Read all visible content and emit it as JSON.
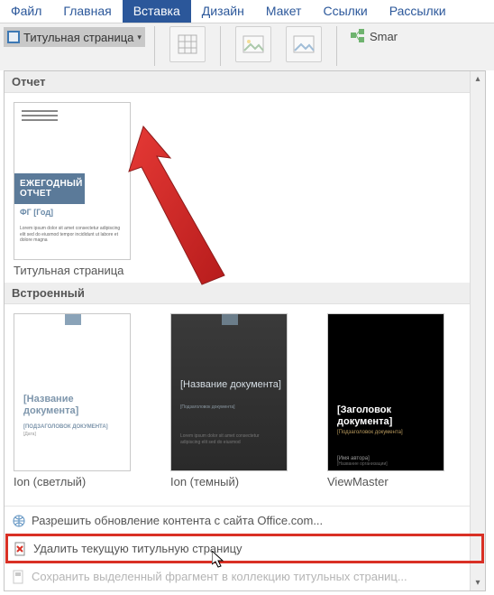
{
  "menubar": {
    "items": [
      {
        "label": "Файл"
      },
      {
        "label": "Главная"
      },
      {
        "label": "Вставка",
        "active": true
      },
      {
        "label": "Дизайн"
      },
      {
        "label": "Макет"
      },
      {
        "label": "Ссылки"
      },
      {
        "label": "Рассылки"
      }
    ]
  },
  "ribbon": {
    "cover_page_label": "Титульная страница",
    "smartart_label": "Smar"
  },
  "gallery": {
    "section1_title": "Отчет",
    "report": {
      "title": "ЕЖЕГОДНЫЙ ОТЧЕТ",
      "subtitle": "ФГ [Год]",
      "label": "Титульная страница"
    },
    "section2_title": "Встроенный",
    "ion_light": {
      "title": "[Название документа]",
      "sub": "[ПОДЗАГОЛОВОК ДОКУМЕНТА]",
      "label": "Ion (светлый)"
    },
    "ion_dark": {
      "title": "[Название документа]",
      "label": "Ion (темный)"
    },
    "viewmaster": {
      "title": "[Заголовок документа]",
      "sub": "[Подзаголовок документа]",
      "foot": "[Имя автора]",
      "label": "ViewMaster"
    }
  },
  "footer": {
    "update": "Разрешить обновление контента с сайта Office.com...",
    "remove": "Удалить текущую титульную страницу",
    "save": "Сохранить выделенный фрагмент в коллекцию титульных страниц..."
  }
}
